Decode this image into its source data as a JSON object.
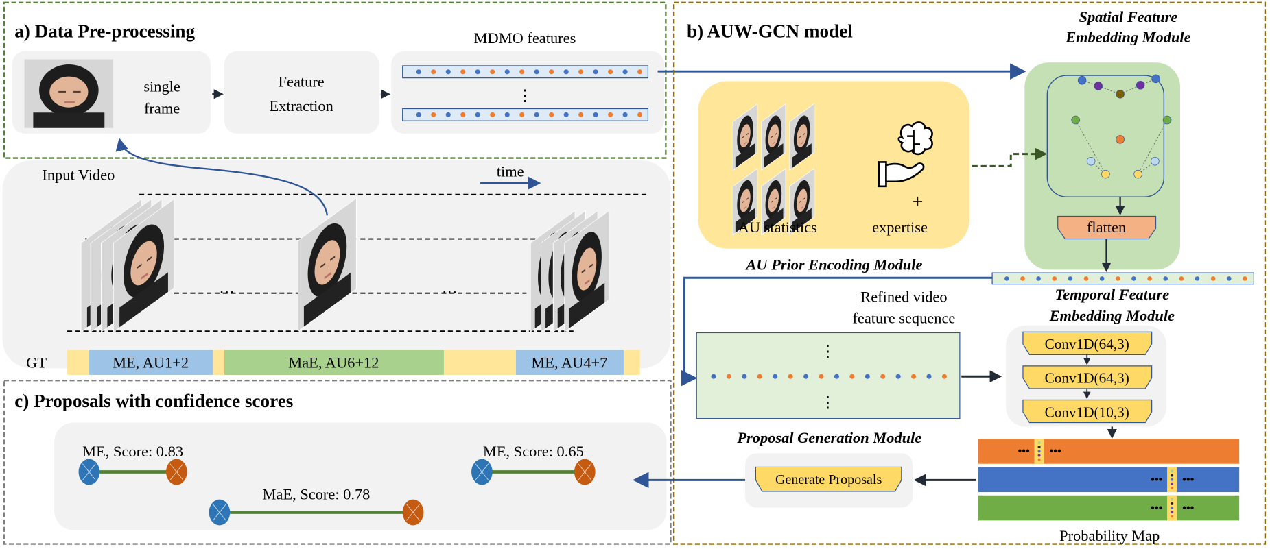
{
  "section_a": {
    "title": "a) Data Pre-processing",
    "single_frame": [
      "single",
      "frame"
    ],
    "feature_extraction": [
      "Feature",
      "Extraction"
    ],
    "mdmo_label": "MDMO features",
    "vdots": "⋮"
  },
  "input_video": {
    "label": "Input Video",
    "time_label": "time",
    "ellipsis": "…",
    "gt_label": "GT",
    "gt_segments": [
      {
        "label": "ME, AU1+2",
        "type": "ME"
      },
      {
        "label": "MaE, AU6+12",
        "type": "MaE"
      },
      {
        "label": "ME, AU4+7",
        "type": "ME"
      }
    ]
  },
  "section_b": {
    "title": "b) AUW-GCN model",
    "spatial_module": [
      "Spatial Feature",
      "Embedding Module"
    ],
    "flatten": "flatten",
    "au_statistics": "AU statistics",
    "plus": "+",
    "expertise": "expertise",
    "au_prior_module": "AU Prior Encoding Module",
    "refined_label": [
      "Refined video",
      "feature sequence"
    ],
    "temporal_module": [
      "Temporal Feature",
      "Embedding Module"
    ],
    "conv_layers": [
      "Conv1D(64,3)",
      "Conv1D(64,3)",
      "Conv1D(10,3)"
    ],
    "proposal_module": "Proposal Generation Module",
    "generate_proposals": "Generate Proposals",
    "probability_map": "Probability Map",
    "dots": "•••"
  },
  "section_c": {
    "title": "c) Proposals with confidence scores",
    "proposals": [
      {
        "label": "ME, Score: 0.83",
        "type": "ME",
        "score": 0.83
      },
      {
        "label": "MaE, Score: 0.78",
        "type": "MaE",
        "score": 0.78
      },
      {
        "label": "ME, Score: 0.65",
        "type": "ME",
        "score": 0.65
      }
    ]
  },
  "colors": {
    "blue_dot": "#4472c4",
    "orange_dot": "#ed7d31",
    "flow_arrow": "#2f5597",
    "gt_background": "#ffe699",
    "gt_me": "#9dc3e6",
    "gt_mae": "#a9d18e",
    "spatial_bg": "#c5e0b4",
    "prior_bg": "#ffe699",
    "conv_fill": "#ffd966",
    "flatten_fill": "#f4b183",
    "prob_orange": "#ed7d31",
    "prob_blue": "#4472c4",
    "prob_green": "#70ad47"
  }
}
